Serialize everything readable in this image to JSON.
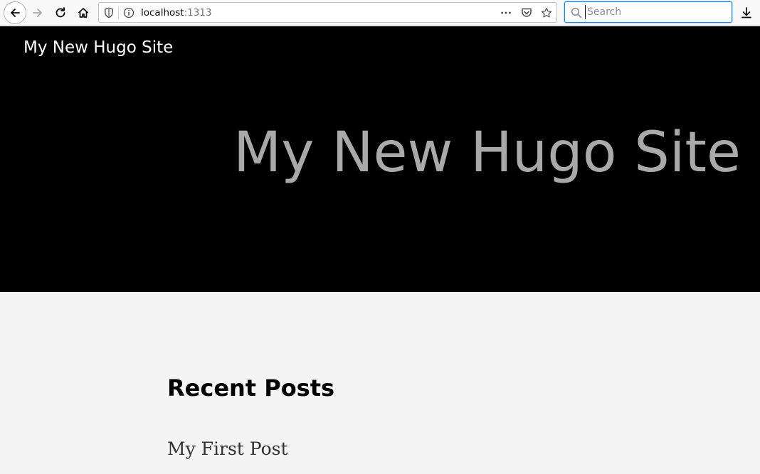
{
  "browser": {
    "url_host": "localhost",
    "url_port": ":1313",
    "search_placeholder": "Search",
    "colors": {
      "toolbar_bg": "#f9f9fa",
      "search_focus": "#0a84ff"
    },
    "icons": {
      "back": "arrow-left-icon",
      "forward": "arrow-right-icon",
      "reload": "reload-icon",
      "home": "home-icon",
      "tracking": "shield-icon",
      "site_info": "info-icon",
      "page_actions": "more-icon",
      "pocket": "pocket-icon",
      "bookmark": "star-icon",
      "search": "search-icon",
      "downloads": "download-icon"
    }
  },
  "site": {
    "nav_title": "My New Hugo Site",
    "hero_title": "My New Hugo Site",
    "colors": {
      "hero_bg": "#000000",
      "hero_title": "#a9a9a9",
      "page_bg": "#f4f4f4"
    }
  },
  "main": {
    "section_heading": "Recent Posts",
    "posts": [
      {
        "title": "My First Post"
      }
    ]
  }
}
